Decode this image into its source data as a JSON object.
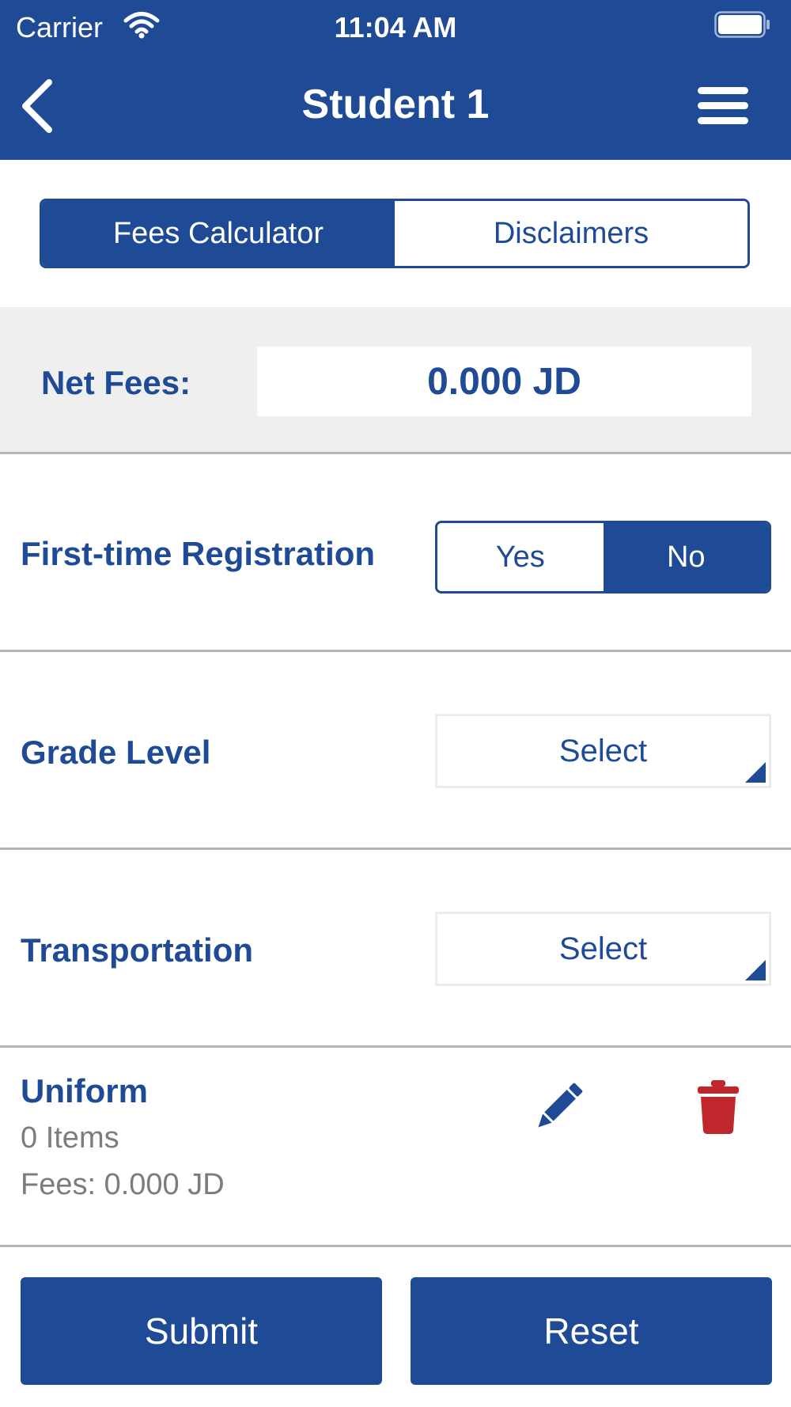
{
  "status_bar": {
    "carrier": "Carrier",
    "time": "11:04 AM",
    "icons": [
      "wifi-icon",
      "battery-icon"
    ]
  },
  "nav": {
    "title": "Student 1",
    "back_icon": "chevron-left-icon",
    "menu_icon": "hamburger-menu-icon"
  },
  "tabs": [
    {
      "label": "Fees Calculator",
      "selected": true
    },
    {
      "label": "Disclaimers",
      "selected": false
    }
  ],
  "net_fees": {
    "label": "Net Fees:",
    "value": "0.000 JD"
  },
  "first_time_registration": {
    "label": "First-time Registration",
    "options": [
      "Yes",
      "No"
    ],
    "selected": "No"
  },
  "grade_level": {
    "label": "Grade Level",
    "value": "Select"
  },
  "transportation": {
    "label": "Transportation",
    "value": "Select"
  },
  "uniform": {
    "title": "Uniform",
    "items": "0 Items",
    "fees": "Fees: 0.000 JD",
    "edit_icon": "pencil-icon",
    "delete_icon": "trash-icon"
  },
  "actions": {
    "submit_label": "Submit",
    "reset_label": "Reset"
  },
  "colors": {
    "primary": "#1e4a96",
    "delete": "#c0272d",
    "muted_text": "#7c7c7c",
    "panel_bg": "#efefef"
  }
}
